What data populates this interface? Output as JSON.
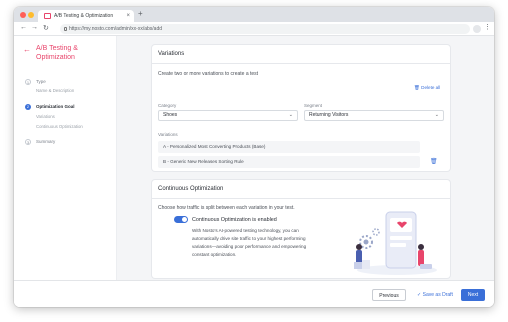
{
  "browser": {
    "tab_title": "A/B Testing & Optimization",
    "tab_close": "×",
    "new_tab": "+",
    "url": "https://my.nosto.com/admin/xx-xx/abs/add",
    "back": "←",
    "forward": "→",
    "reload": "↻"
  },
  "sidebar": {
    "back_arrow": "←",
    "title": "A/B Testing & Optimization",
    "steps": [
      {
        "number": "1",
        "label": "Type",
        "sub": [
          "Name & Description"
        ]
      },
      {
        "number": "2",
        "label": "Optimization Goal",
        "sub": [
          "Variations",
          "Continuous Optimization"
        ]
      },
      {
        "number": "3",
        "label": "Summary",
        "sub": []
      }
    ]
  },
  "variations": {
    "title": "Variations",
    "subtitle": "Create two or more variations to create a test",
    "delete_all": "Delete all",
    "category_label": "Category",
    "category_value": "Shoes",
    "segment_label": "Segment",
    "segment_value": "Returning Visitors",
    "list_label": "Variations",
    "rows": [
      "A - Personalized Most Converting Products (Base)",
      "B - Generic New Releases Sorting Rule"
    ]
  },
  "continuous": {
    "title": "Continuous Optimization",
    "subtitle": "Choose how traffic is split between each variation in your test.",
    "toggle_label": "Continuous Optimization is enabled",
    "toggle_on": true,
    "description": [
      "With Nosto's AI-powered testing technology, you can",
      "automatically drive site traffic to your highest performing",
      "variations—avoiding poor performance and empowering",
      "constant optimization."
    ]
  },
  "footer": {
    "previous": "Previous",
    "save_draft": "Save as Draft",
    "next": "Next"
  },
  "colors": {
    "accent": "#e8456b",
    "primary": "#3a6fd8"
  }
}
